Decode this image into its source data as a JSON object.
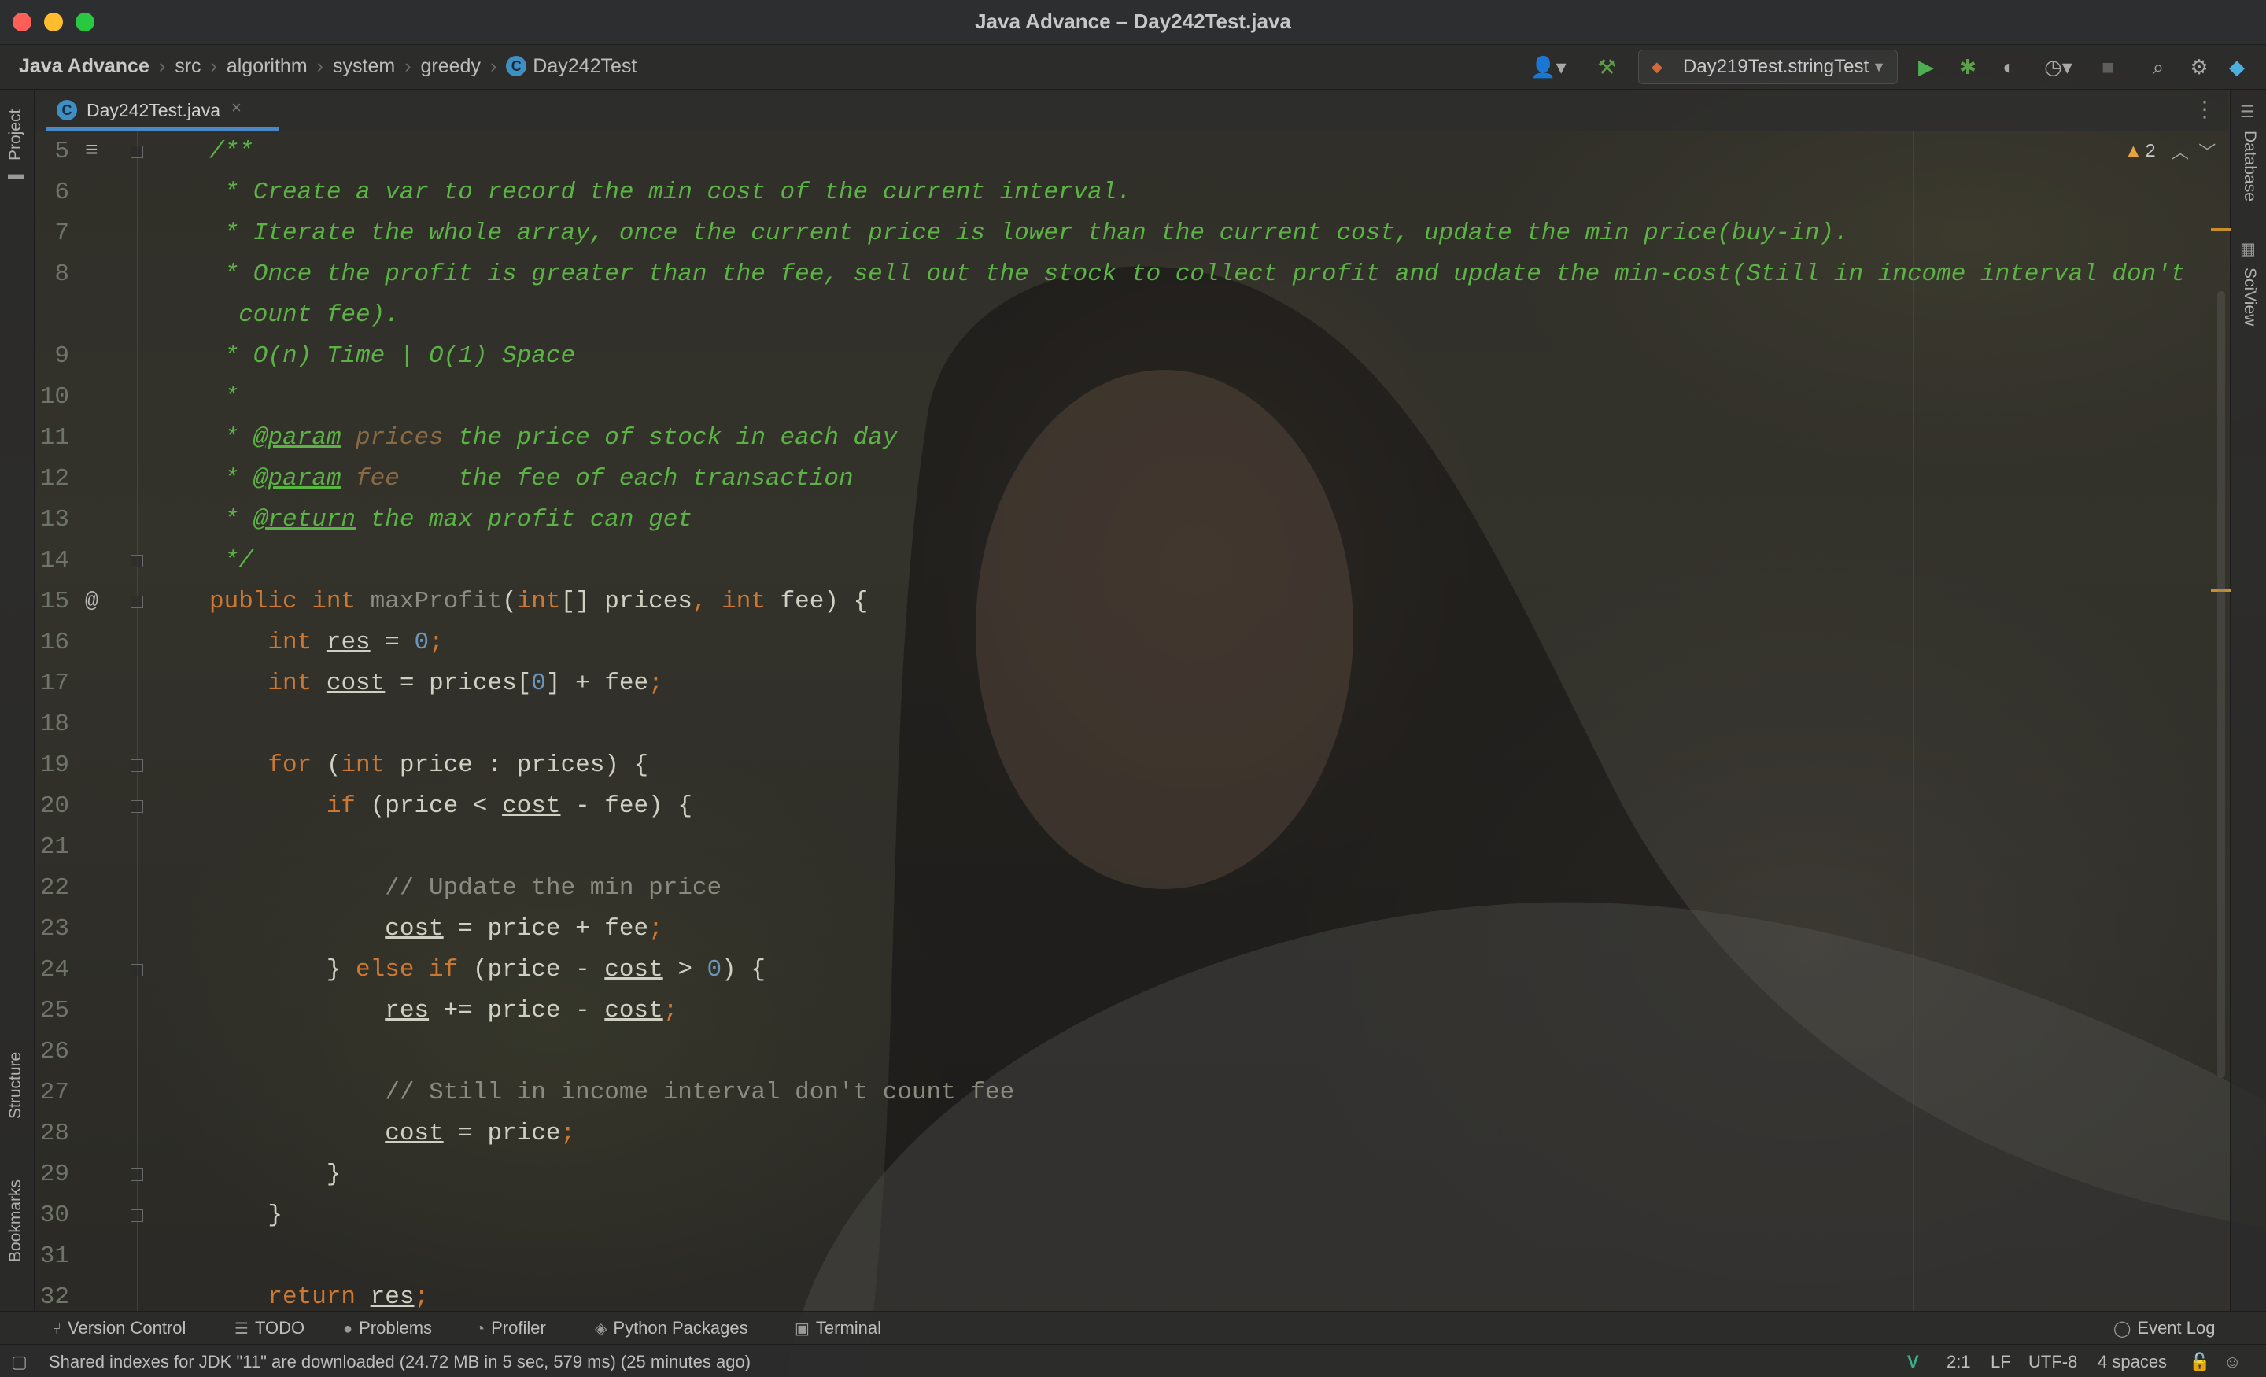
{
  "window": {
    "title": "Java Advance – Day242Test.java"
  },
  "breadcrumbs": [
    "Java Advance",
    "src",
    "algorithm",
    "system",
    "greedy",
    "Day242Test"
  ],
  "toolbar": {
    "run_config": "Day219Test.stringTest"
  },
  "tab": {
    "label": "Day242Test.java",
    "close": "×"
  },
  "sidebar": {
    "left_top": "Project",
    "left_bottom_1": "Structure",
    "left_bottom_2": "Bookmarks",
    "right_1": "Database",
    "right_2": "SciView"
  },
  "inspection": {
    "warning_count": "2"
  },
  "gutter": {
    "at_marker": "@"
  },
  "code_lines": [
    {
      "n": "5",
      "html": "<span class=\"cmt\">/**</span>"
    },
    {
      "n": "6",
      "html": "<span class=\"cmt\"> * Create a var to record the min cost of the current interval.</span>"
    },
    {
      "n": "7",
      "html": "<span class=\"cmt\"> * Iterate the whole array, once the current price is lower than the current cost, update the min price(buy-in).</span>"
    },
    {
      "n": "8",
      "html": "<span class=\"cmt\"> * Once the profit is greater than the fee, sell out the stock to collect profit and update the min-cost(Still in income interval don't</span>"
    },
    {
      "n": "",
      "html": "<span class=\"cmt\">  count fee).</span>"
    },
    {
      "n": "9",
      "html": "<span class=\"cmt\"> * O(n) Time | O(1) Space</span>"
    },
    {
      "n": "10",
      "html": "<span class=\"cmt\"> *</span>"
    },
    {
      "n": "11",
      "html": "<span class=\"cmt\"> * </span><span class=\"tag\">@param</span><span class=\"cmt\"> </span><span class=\"pname\">prices</span><span class=\"cmt\"> the price of stock in each day</span>"
    },
    {
      "n": "12",
      "html": "<span class=\"cmt\"> * </span><span class=\"tag\">@param</span><span class=\"cmt\"> </span><span class=\"pname\">fee</span><span class=\"cmt\">    the fee of each transaction</span>"
    },
    {
      "n": "13",
      "html": "<span class=\"cmt\"> * </span><span class=\"tag\">@return</span><span class=\"cmt\"> the max profit can get</span>"
    },
    {
      "n": "14",
      "html": "<span class=\"cmt\"> */</span>"
    },
    {
      "n": "15",
      "html": "<span class=\"kw\">public int </span><span class=\"fn\">maxProfit</span>(<span class=\"kw\">int</span>[] prices<span class=\"kw\">, int </span>fee) {"
    },
    {
      "n": "16",
      "html": "    <span class=\"kw\">int </span><span class=\"var\">res</span> = <span class=\"num\">0</span><span class=\"kw\">;</span>"
    },
    {
      "n": "17",
      "html": "    <span class=\"kw\">int </span><span class=\"var\">cost</span> = prices[<span class=\"num\">0</span>] + fee<span class=\"kw\">;</span>"
    },
    {
      "n": "18",
      "html": ""
    },
    {
      "n": "19",
      "html": "    <span class=\"kw\">for </span>(<span class=\"kw\">int </span>price : prices) {"
    },
    {
      "n": "20",
      "html": "        <span class=\"kw\">if </span>(price &lt; <span class=\"var\">cost</span> - fee) {"
    },
    {
      "n": "21",
      "html": ""
    },
    {
      "n": "22",
      "html": "            <span class=\"lcmt\">// Update the min price</span>"
    },
    {
      "n": "23",
      "html": "            <span class=\"var\">cost</span> = price + fee<span class=\"kw\">;</span>"
    },
    {
      "n": "24",
      "html": "        } <span class=\"kw\">else if </span>(price - <span class=\"var\">cost</span> &gt; <span class=\"num\">0</span>) {"
    },
    {
      "n": "25",
      "html": "            <span class=\"var\">res</span> += price - <span class=\"var\">cost</span><span class=\"kw\">;</span>"
    },
    {
      "n": "26",
      "html": ""
    },
    {
      "n": "27",
      "html": "            <span class=\"lcmt\">// Still in income interval don't count fee</span>"
    },
    {
      "n": "28",
      "html": "            <span class=\"var\">cost</span> = price<span class=\"kw\">;</span>"
    },
    {
      "n": "29",
      "html": "        }"
    },
    {
      "n": "30",
      "html": "    }"
    },
    {
      "n": "31",
      "html": ""
    },
    {
      "n": "32",
      "html": "    <span class=\"kw\">return </span><span class=\"var\">res</span><span class=\"kw\">;</span>"
    }
  ],
  "tool_windows": [
    "Version Control",
    "TODO",
    "Problems",
    "Profiler",
    "Python Packages",
    "Terminal"
  ],
  "event_log": "Event Log",
  "status": {
    "message": "Shared indexes for JDK \"11\" are downloaded (24.72 MB in 5 sec, 579 ms) (25 minutes ago)",
    "position": "2:1",
    "line_sep": "LF",
    "encoding": "UTF-8",
    "indent": "4 spaces"
  },
  "colors": {
    "keyword": "#cc7832",
    "doc_comment": "#5bb245",
    "number": "#6897bb",
    "accent": "#4a88c7"
  }
}
